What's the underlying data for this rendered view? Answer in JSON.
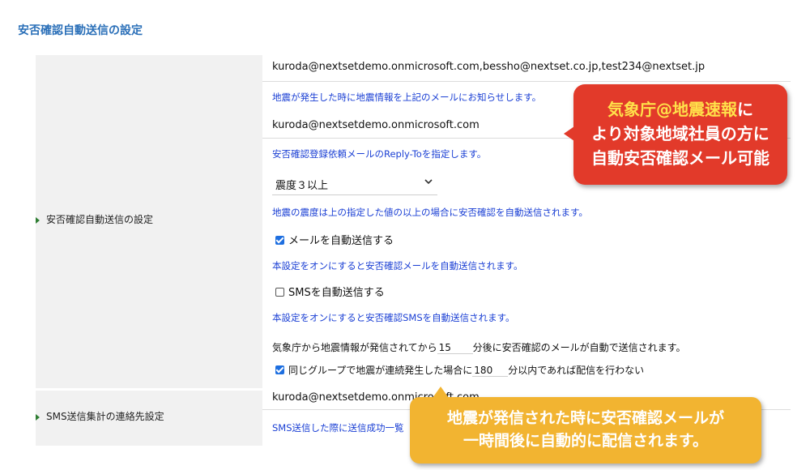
{
  "page_title": "安否確認自動送信の設定",
  "rows": {
    "auto_send_label": "安否確認自動送信の設定",
    "sms_label": "SMS送信集計の連絡先設定"
  },
  "fields": {
    "notify_emails": "kuroda@nextsetdemo.onmicrosoft.com,bessho@nextset.co.jp,test234@nextset.jp",
    "notify_emails_hint": "地震が発生した時に地震情報を上記のメールにお知らせします。",
    "reply_to": "kuroda@nextsetdemo.onmicrosoft.com",
    "reply_to_hint": "安否確認登録依頼メールのReply-Toを指定します。",
    "intensity_select": "震度３以上",
    "intensity_hint": "地震の震度は上の指定した値の以上の場合に安否確認を自動送信されます。",
    "mail_auto_label": "メールを自動送信する",
    "mail_auto_checked": true,
    "mail_auto_hint": "本設定をオンにすると安否確認メールを自動送信されます。",
    "sms_auto_label": "SMSを自動送信する",
    "sms_auto_checked": false,
    "sms_auto_hint": "本設定をオンにすると安否確認SMSを自動送信されます。",
    "delay_prefix": "気象庁から地震情報が発信されてから",
    "delay_value": "15",
    "delay_suffix": "分後に安否確認のメールが自動で送信されます。",
    "group_label": "同じグループで地震が連続発生した場合に",
    "group_checked": true,
    "group_value": "180",
    "group_suffix": "分以内であれば配信を行わない",
    "sms_contact": "kuroda@nextsetdemo.onmicrosoft.com",
    "sms_contact_hint": "SMS送信した際に送信成功一覧"
  },
  "callouts": {
    "red_line1_a": "気象庁@地震速報",
    "red_line1_b": "に",
    "red_line2": "より対象地域社員の方に",
    "red_line3": "自動安否確認メール可能",
    "orange_line1": "地震が発信された時に安否確認メールが",
    "orange_line2": "一時間後に自動的に配信されます。"
  },
  "colors": {
    "title": "#2a6fb8",
    "hint": "#1a3fd4",
    "label_bg": "#f1f1f1",
    "red_callout": "#e23a2a",
    "orange_callout": "#f2b431",
    "checkbox": "#1e6fe0"
  }
}
